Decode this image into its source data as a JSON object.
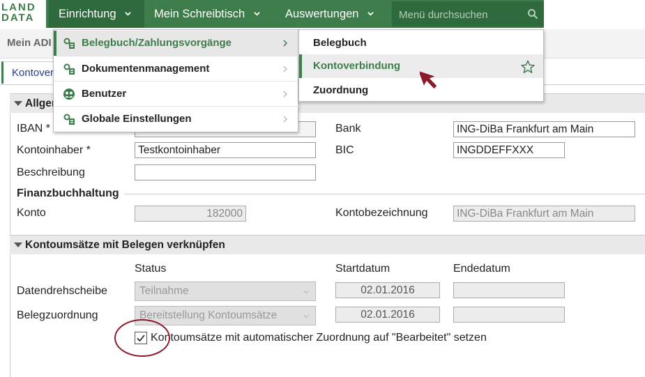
{
  "logo": {
    "line1": "LAND",
    "line2": "DATA"
  },
  "topnav": {
    "einrichtung": "Einrichtung",
    "schreibtisch": "Mein Schreibtisch",
    "auswertungen": "Auswertungen",
    "search_placeholder": "Menü durchsuchen"
  },
  "subheader": {
    "title": "Mein ADI"
  },
  "tab": {
    "label": "Kontover"
  },
  "menu": {
    "items": [
      {
        "label": "Belegbuch/Zahlungsvorgänge"
      },
      {
        "label": "Dokumentenmanagement"
      },
      {
        "label": "Benutzer"
      },
      {
        "label": "Globale Einstellungen"
      }
    ],
    "submenu": [
      {
        "label": "Belegbuch"
      },
      {
        "label": "Kontoverbindung"
      },
      {
        "label": "Zuordnung"
      }
    ]
  },
  "section1": {
    "title": "Allgen",
    "iban_label": "IBAN *",
    "iban_value": "",
    "kontoinhaber_label": "Kontoinhaber *",
    "kontoinhaber_value": "Testkontoinhaber",
    "beschreibung_label": "Beschreibung",
    "beschreibung_value": "",
    "bank_label": "Bank",
    "bank_value": "ING-DiBa Frankfurt am Main",
    "bic_label": "BIC",
    "bic_value": "INGDDEFFXXX",
    "finanz_title": "Finanzbuchhaltung",
    "konto_label": "Konto",
    "konto_value": "182000",
    "kontobez_label": "Kontobezeichnung",
    "kontobez_value": "ING-DiBa Frankfurt am Main"
  },
  "section2": {
    "title": "Kontoumsätze mit Belegen verknüpfen",
    "col_status": "Status",
    "col_start": "Startdatum",
    "col_end": "Endedatum",
    "row1_label": "Datendrehscheibe",
    "row1_status": "Teilnahme",
    "row1_start": "02.01.2016",
    "row1_end": "",
    "row2_label": "Belegzuordnung",
    "row2_status": "Bereitstellung Kontoumsätze",
    "row2_start": "02.01.2016",
    "row2_end": "",
    "checkbox_label": "Kontoumsätze mit automatischer Zuordnung auf \"Bearbeitet\" setzen",
    "checkbox_checked": true
  },
  "colors": {
    "brand_green": "#3c7d4b",
    "annotation_red": "#8b1a2a"
  }
}
